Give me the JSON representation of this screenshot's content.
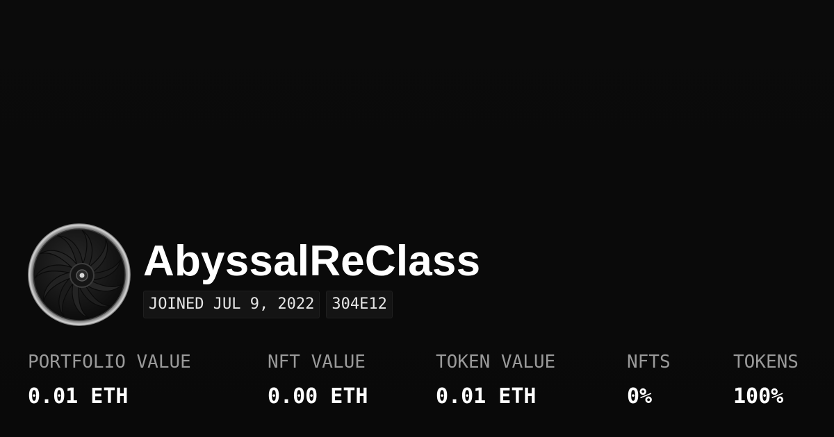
{
  "profile": {
    "username": "AbyssalReClass",
    "joined": "JOINED JUL 9, 2022",
    "address": "304E12",
    "avatar_icon": "turbine-fan-icon"
  },
  "stats": [
    {
      "label": "PORTFOLIO VALUE",
      "value": "0.01 ETH"
    },
    {
      "label": "NFT VALUE",
      "value": "0.00 ETH"
    },
    {
      "label": "TOKEN VALUE",
      "value": "0.01 ETH"
    },
    {
      "label": "NFTS",
      "value": "0%"
    },
    {
      "label": "TOKENS",
      "value": "100%"
    }
  ],
  "colors": {
    "background": "#0a0a0a",
    "text_primary": "#ffffff",
    "text_muted": "#9a9a9a",
    "tag_background": "#141414"
  }
}
